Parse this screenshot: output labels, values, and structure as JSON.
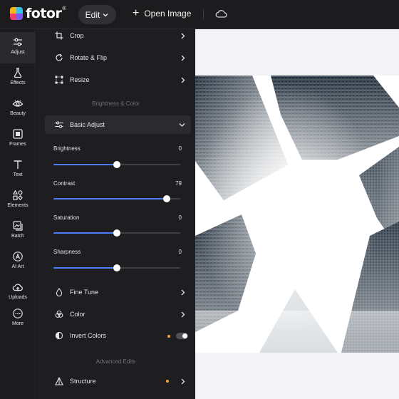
{
  "brand": {
    "name": "fotor",
    "reg": "®",
    "colors": [
      "#f5b814",
      "#33c3f0",
      "#ef3e6c",
      "#7a5cf5"
    ]
  },
  "topbar": {
    "edit_label": "Edit",
    "open_image_label": "Open Image",
    "cloud_icon": "cloud-icon"
  },
  "rail": {
    "items": [
      {
        "label": "Adjust",
        "icon": "sliders-icon",
        "active": true
      },
      {
        "label": "Effects",
        "icon": "flask-icon",
        "active": false
      },
      {
        "label": "Beauty",
        "icon": "eye-icon",
        "active": false
      },
      {
        "label": "Frames",
        "icon": "frame-icon",
        "active": false
      },
      {
        "label": "Text",
        "icon": "text-icon",
        "active": false
      },
      {
        "label": "Elements",
        "icon": "shapes-icon",
        "active": false
      },
      {
        "label": "Batch",
        "icon": "batch-icon",
        "active": false
      },
      {
        "label": "AI Art",
        "icon": "ai-art-icon",
        "active": false
      },
      {
        "label": "Uploads",
        "icon": "upload-cloud-icon",
        "active": false
      },
      {
        "label": "More",
        "icon": "more-icon",
        "active": false
      }
    ]
  },
  "panel": {
    "tools": [
      {
        "label": "Crop",
        "icon": "crop-icon"
      },
      {
        "label": "Rotate & Flip",
        "icon": "rotate-icon"
      },
      {
        "label": "Resize",
        "icon": "resize-icon"
      }
    ],
    "section_brightness_color": "Brightness & Color",
    "basic_adjust_label": "Basic Adjust",
    "sliders": [
      {
        "label": "Brightness",
        "value": "0",
        "position": 0.5
      },
      {
        "label": "Contrast",
        "value": "79",
        "position": 0.895
      },
      {
        "label": "Saturation",
        "value": "0",
        "position": 0.5
      },
      {
        "label": "Sharpness",
        "value": "0",
        "position": 0.5
      }
    ],
    "fine_tune_label": "Fine Tune",
    "color_label": "Color",
    "invert_colors_label": "Invert Colors",
    "invert_colors_on": false,
    "section_advanced": "Advanced Edits",
    "structure_label": "Structure"
  },
  "accent_color": "#4f7df9",
  "premium_dot_color": "#f5a524"
}
